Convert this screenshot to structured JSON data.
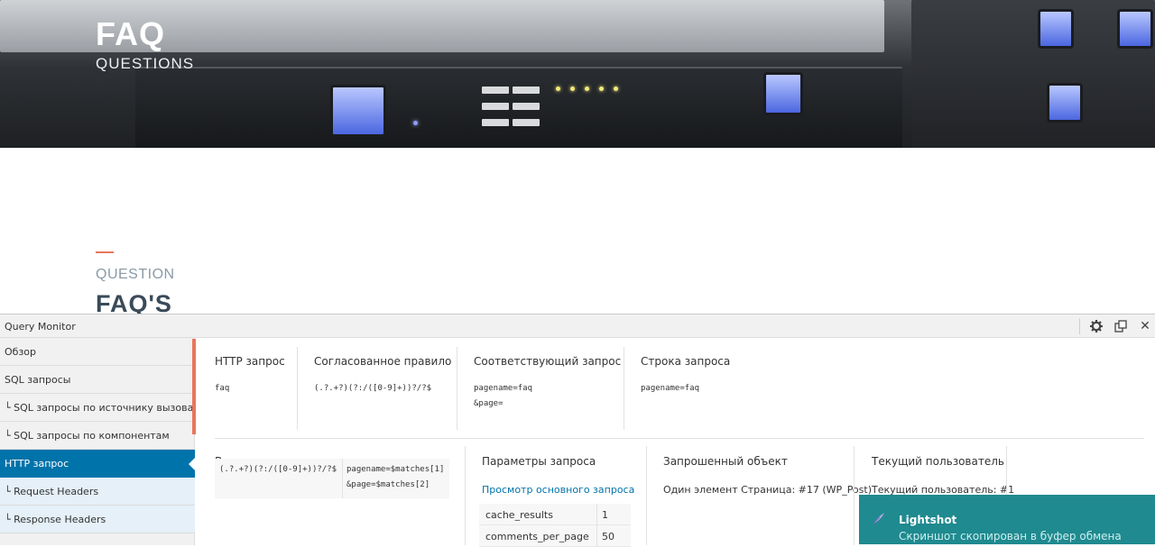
{
  "hero": {
    "title": "FAQ",
    "subtitle": "QUESTIONS"
  },
  "section": {
    "subtitle": "QUESTION",
    "title": "FAQ'S"
  },
  "qm": {
    "title": "Query Monitor",
    "controls": [
      "gear-icon",
      "popout-icon",
      "close-icon"
    ],
    "close_glyph": "✕",
    "nav": [
      {
        "label": "Обзор",
        "state": "normal"
      },
      {
        "label": "SQL запросы",
        "state": "normal"
      },
      {
        "label": "└ SQL запросы по источнику вызова",
        "state": "normal"
      },
      {
        "label": "└ SQL запросы по компонентам",
        "state": "normal"
      },
      {
        "label": "HTTP запрос",
        "state": "active"
      },
      {
        "label": "└ Request Headers",
        "state": "sub"
      },
      {
        "label": "└ Response Headers",
        "state": "sub"
      }
    ],
    "request": {
      "http_header": "HTTP запрос",
      "http_value": "faq",
      "rule_header": "Согласованное правило",
      "rule_value": "(.?.+?)(?:/([0-9]+))?/?$",
      "query_header": "Соответствующий запрос",
      "query_value_1": "pagename=faq",
      "query_value_2": "&page=",
      "string_header": "Строка запроса",
      "string_value": "pagename=faq"
    },
    "rewrite": {
      "header": "Все соответствия правилам перезаписи",
      "pattern": "(.?.+?)(?:/([0-9]+))?/?$",
      "target_1": "pagename=$matches[1]",
      "target_2": "&page=$matches[2]"
    },
    "params": {
      "header": "Параметры запроса",
      "link": "Просмотр основного запроса",
      "rows": [
        {
          "key": "cache_results",
          "value": "1"
        },
        {
          "key": "comments_per_page",
          "value": "50"
        }
      ]
    },
    "object": {
      "header": "Запрошенный объект",
      "value": "Один элемент Страница: #17 (WP_Post)"
    },
    "user": {
      "header": "Текущий пользователь",
      "value": "Текущий пользователь: #1"
    }
  },
  "toast": {
    "icon": "feather-icon",
    "title": "Lightshot",
    "message": "Скриншот скопирован в буфер обмена",
    "color": "#1f8a8f"
  },
  "colors": {
    "accent": "#e8765c",
    "active_nav": "#0073aa",
    "link": "#0073aa"
  }
}
